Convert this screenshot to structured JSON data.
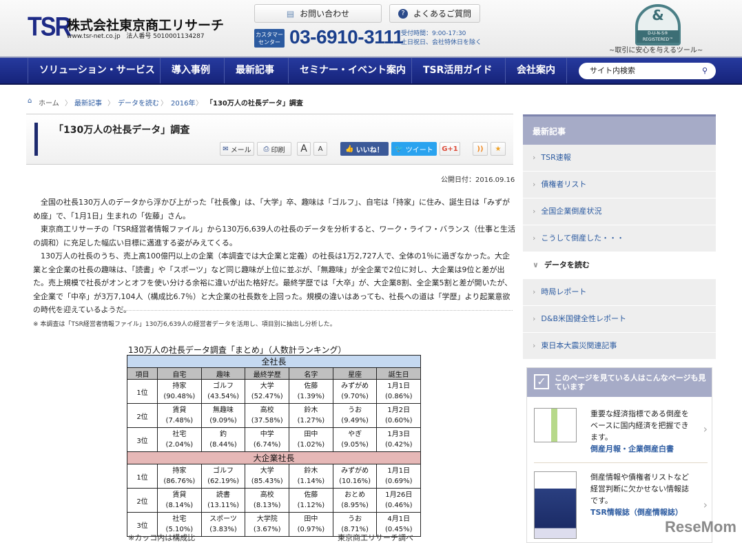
{
  "header": {
    "logo": "TSR",
    "company": "株式会社東京商工リサーチ",
    "url": "www.tsr-net.co.jp",
    "corp_number": "法人番号 5010001134287",
    "contact_btn": "お問い合わせ",
    "faq_btn": "よくあるご質問",
    "customer_center": "カスタマーセンター",
    "phone": "03-6910-3111",
    "hours": "受付時間：9:00-17:30",
    "holidays": "土日祝日、会社特休日を除く",
    "duns_tag": "D-U-N-S® REGISTERED™",
    "duns_caption": "~取引に安心を与えるツール~"
  },
  "nav": {
    "items": [
      "ソリューション・サービス",
      "導入事例",
      "最新記事",
      "セミナー・イベント案内",
      "TSR活用ガイド",
      "会社案内"
    ],
    "search_placeholder": "サイト内検索"
  },
  "breadcrumb": [
    "ホーム",
    "最新記事",
    "データを読む",
    "2016年",
    "「130万人の社長データ」調査"
  ],
  "article": {
    "title": "「130万人の社長データ」調査",
    "tools": {
      "mail": "メール",
      "print": "印刷",
      "font_large": "A",
      "font_small": "A",
      "like": "いいね！",
      "tweet": "ツイート",
      "gplus": "G+1"
    },
    "date": "公開日付：2016.09.16",
    "paragraphs": [
      "全国の社長130万人のデータから浮かび上がった「社長像」は、「大学」卒、趣味は「ゴルフ」、自宅は「持家」に住み、誕生日は「みずがめ座」で、「1月1日」生まれの「佐藤」さん。",
      "東京商工リサーチの「TSR経営者情報ファイル」から130万6,639人の社長のデータを分析すると、ワーク・ライフ・バランス（仕事と生活の調和）に充足した幅広い目標に邁進する姿がみえてくる。",
      "130万人の社長のうち、売上高100億円以上の企業（本調査では大企業と定義）の社長は1万2,727人で、全体の1％に過ぎなかった。大企業と全企業の社長の趣味は、「読書」や「スポーツ」など同じ趣味が上位に並ぶが、「無趣味」が全企業で2位に対し、大企業は9位と差が出た。売上規模で社長がオンとオフを使い分ける余裕に違いが出た格好だ。最終学歴では「大卒」が、大企業8割、全企業5割と差が開いたが、全企業で「中卒」が3万7,104人（構成比6.7％）と大企業の社長数を上回った。規模の違いはあっても、社長への道は「学歴」より起業意欲の時代を迎えているようだ。"
    ],
    "note": "※ 本調査は「TSR経営者情報ファイル」130万6,639人の経営者データを活用し、項目別に抽出し分析した。"
  },
  "table": {
    "caption": "130万人の社長データ調査「まとめ」（人数計ランキング）",
    "columns": [
      "項目",
      "自宅",
      "趣味",
      "最終学歴",
      "名字",
      "星座",
      "誕生日"
    ],
    "sections": [
      {
        "name": "全社長",
        "rows": [
          {
            "rank": "1位",
            "cells": [
              [
                "持家",
                "(90.48%)"
              ],
              [
                "ゴルフ",
                "(43.54%)"
              ],
              [
                "大学",
                "(52.47%)"
              ],
              [
                "佐藤",
                "(1.39%)"
              ],
              [
                "みずがめ",
                "(9.70%)"
              ],
              [
                "1月1日",
                "(0.86%)"
              ]
            ]
          },
          {
            "rank": "2位",
            "cells": [
              [
                "賃貸",
                "(7.48%)"
              ],
              [
                "無趣味",
                "(9.09%)"
              ],
              [
                "高校",
                "(37.58%)"
              ],
              [
                "鈴木",
                "(1.27%)"
              ],
              [
                "うお",
                "(9.49%)"
              ],
              [
                "1月2日",
                "(0.60%)"
              ]
            ]
          },
          {
            "rank": "3位",
            "cells": [
              [
                "社宅",
                "(2.04%)"
              ],
              [
                "釣",
                "(8.44%)"
              ],
              [
                "中学",
                "(6.74%)"
              ],
              [
                "田中",
                "(1.02%)"
              ],
              [
                "やぎ",
                "(9.05%)"
              ],
              [
                "1月3日",
                "(0.42%)"
              ]
            ]
          }
        ]
      },
      {
        "name": "大企業社長",
        "rows": [
          {
            "rank": "1位",
            "cells": [
              [
                "持家",
                "(86.76%)"
              ],
              [
                "ゴルフ",
                "(62.19%)"
              ],
              [
                "大学",
                "(85.43%)"
              ],
              [
                "鈴木",
                "(1.14%)"
              ],
              [
                "みずがめ",
                "(10.16%)"
              ],
              [
                "1月1日",
                "(0.69%)"
              ]
            ]
          },
          {
            "rank": "2位",
            "cells": [
              [
                "賃貸",
                "(8.14%)"
              ],
              [
                "読書",
                "(13.11%)"
              ],
              [
                "高校",
                "(8.13%)"
              ],
              [
                "佐藤",
                "(1.12%)"
              ],
              [
                "おとめ",
                "(8.95%)"
              ],
              [
                "1月26日",
                "(0.46%)"
              ]
            ]
          },
          {
            "rank": "3位",
            "cells": [
              [
                "社宅",
                "(5.10%)"
              ],
              [
                "スポーツ",
                "(3.83%)"
              ],
              [
                "大学院",
                "(3.67%)"
              ],
              [
                "田中",
                "(0.97%)"
              ],
              [
                "うお",
                "(8.71%)"
              ],
              [
                "4月1日",
                "(0.45%)"
              ]
            ]
          }
        ]
      }
    ],
    "footnote_left": "※カッコ内は構成比",
    "footnote_right": "東京商工リサーチ調べ"
  },
  "sidebar": {
    "heading": "最新記事",
    "items": [
      "TSR速報",
      "債権者リスト",
      "全国企業倒産状況",
      "こうして倒産した・・・",
      "データを読む",
      "時局レポート",
      "D&B米国健全性レポート",
      "東日本大震災関連記事"
    ],
    "active_index": 4,
    "related": {
      "heading": "このページを見ている人はこんなページも見ています",
      "items": [
        {
          "text": "重要な経済指標である倒産をベースに国内経済を把握できます。",
          "link": "倒産月報・企業倒産白書"
        },
        {
          "text": "倒産情報や債権者リストなど経営判断に欠かせない情報誌です。",
          "link": "TSR情報誌（倒産情報誌）"
        }
      ]
    }
  },
  "watermark": "ReseMom"
}
